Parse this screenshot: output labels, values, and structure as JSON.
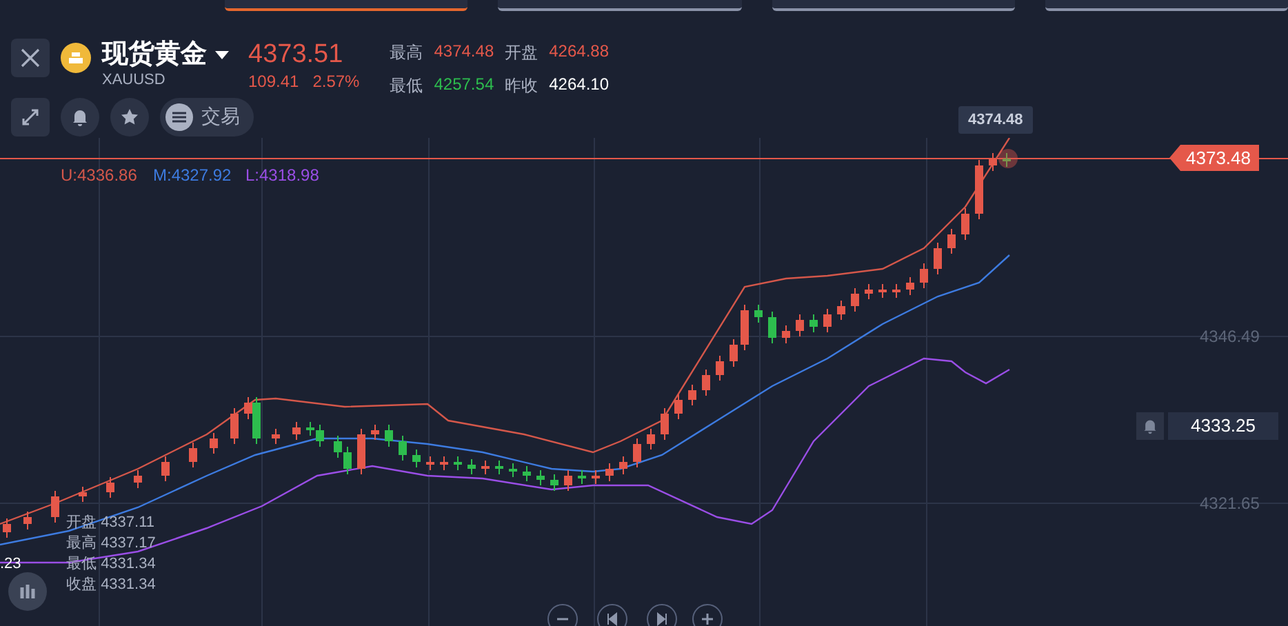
{
  "market_tabs": [
    {
      "selected": true
    },
    {
      "selected": false
    },
    {
      "selected": false
    },
    {
      "selected": false
    }
  ],
  "header": {
    "name": "现货黄金",
    "symbol": "XAUUSD",
    "price": "4373.51",
    "change": "109.41",
    "change_pct": "2.57%",
    "stats": [
      {
        "label": "最高",
        "value": "4374.48",
        "color": "#e5584a"
      },
      {
        "label": "开盘",
        "value": "4264.88",
        "color": "#e5584a"
      },
      {
        "label": "最低",
        "value": "4257.54",
        "color": "#2dbd4e"
      },
      {
        "label": "昨收",
        "value": "4264.10",
        "color": "#ffffff"
      }
    ]
  },
  "toolbar": {
    "trade_label": "交易"
  },
  "chart": {
    "indicators": [
      {
        "label": "U:4336.86",
        "color": "#d4574a"
      },
      {
        "label": "M:4327.92",
        "color": "#3d7be0"
      },
      {
        "label": "L:4318.98",
        "color": "#9a4ee6"
      }
    ],
    "high_tag": "4374.48",
    "current_price": "4373.48",
    "axis_labels": [
      "4346.49",
      "4321.65"
    ],
    "alert_price": "4333.25",
    "cut_label": ".23",
    "ohlc": [
      {
        "label": "开盘",
        "value": "4337.11"
      },
      {
        "label": "最高",
        "value": "4337.17"
      },
      {
        "label": "最低",
        "value": "4331.34"
      },
      {
        "label": "收盘",
        "value": "4331.34"
      }
    ]
  }
}
